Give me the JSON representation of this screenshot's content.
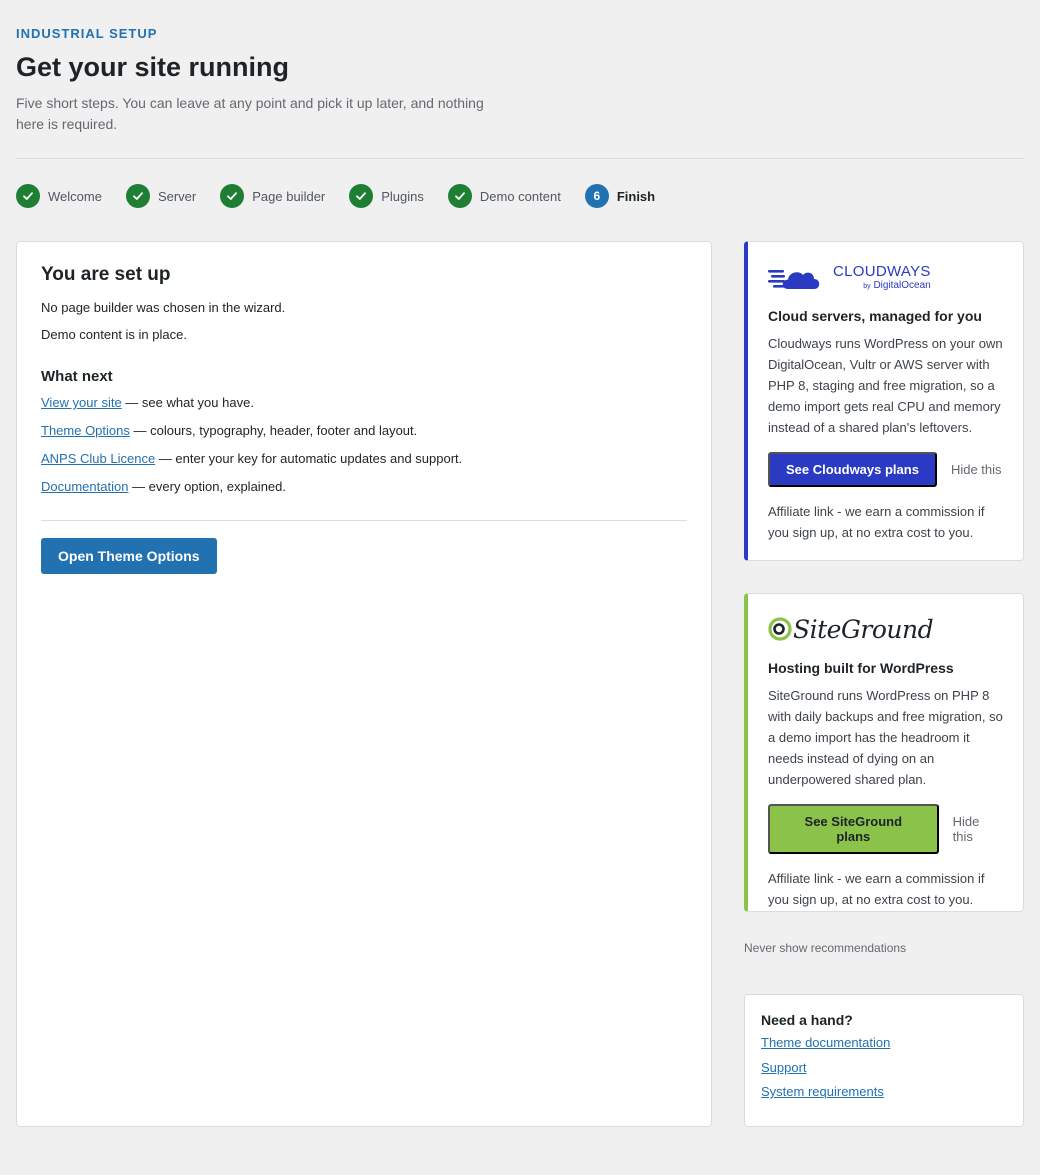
{
  "header": {
    "eyebrow": "INDUSTRIAL SETUP",
    "title": "Get your site running",
    "subtitle": "Five short steps. You can leave at any point and pick it up later, and nothing here is required."
  },
  "steps": [
    {
      "label": "Welcome",
      "status": "done"
    },
    {
      "label": "Server",
      "status": "done"
    },
    {
      "label": "Page builder",
      "status": "done"
    },
    {
      "label": "Plugins",
      "status": "done"
    },
    {
      "label": "Demo content",
      "status": "done"
    },
    {
      "label": "Finish",
      "status": "current",
      "number": "6"
    }
  ],
  "main": {
    "title": "You are set up",
    "lines": [
      "No page builder was chosen in the wizard.",
      "Demo content is in place."
    ],
    "next_title": "What next",
    "next_items": [
      {
        "link": "View your site",
        "text": " — see what you have."
      },
      {
        "link": "Theme Options",
        "text": " — colours, typography, header, footer and layout."
      },
      {
        "link": "ANPS Club Licence",
        "text": " — enter your key for automatic updates and support."
      },
      {
        "link": "Documentation",
        "text": " — every option, explained."
      }
    ],
    "button": "Open Theme Options"
  },
  "cloudways": {
    "logo_text": "CLOUDWAYS",
    "logo_by": "by",
    "logo_sub": "DigitalOcean",
    "title": "Cloud servers, managed for you",
    "body": "Cloudways runs WordPress on your own DigitalOcean, Vultr or AWS server with PHP 8, staging and free migration, so a demo import gets real CPU and memory instead of a shared plan's leftovers.",
    "button": "See Cloudways plans",
    "hide": "Hide this",
    "note": "Affiliate link - we earn a commission if you sign up, at no extra cost to you.",
    "color": "#2b3ac2"
  },
  "siteground": {
    "logo_text": "SiteGround",
    "title": "Hosting built for WordPress",
    "body": "SiteGround runs WordPress on PHP 8 with daily backups and free migration, so a demo import has the headroom it needs instead of dying on an underpowered shared plan.",
    "button": "See SiteGround plans",
    "hide": "Hide this",
    "note": "Affiliate link - we earn a commission if you sign up, at no extra cost to you.",
    "color": "#8bc34a"
  },
  "never_show": "Never show recommendations",
  "help": {
    "title": "Need a hand?",
    "links": [
      "Theme documentation",
      "Support",
      "System requirements"
    ]
  }
}
